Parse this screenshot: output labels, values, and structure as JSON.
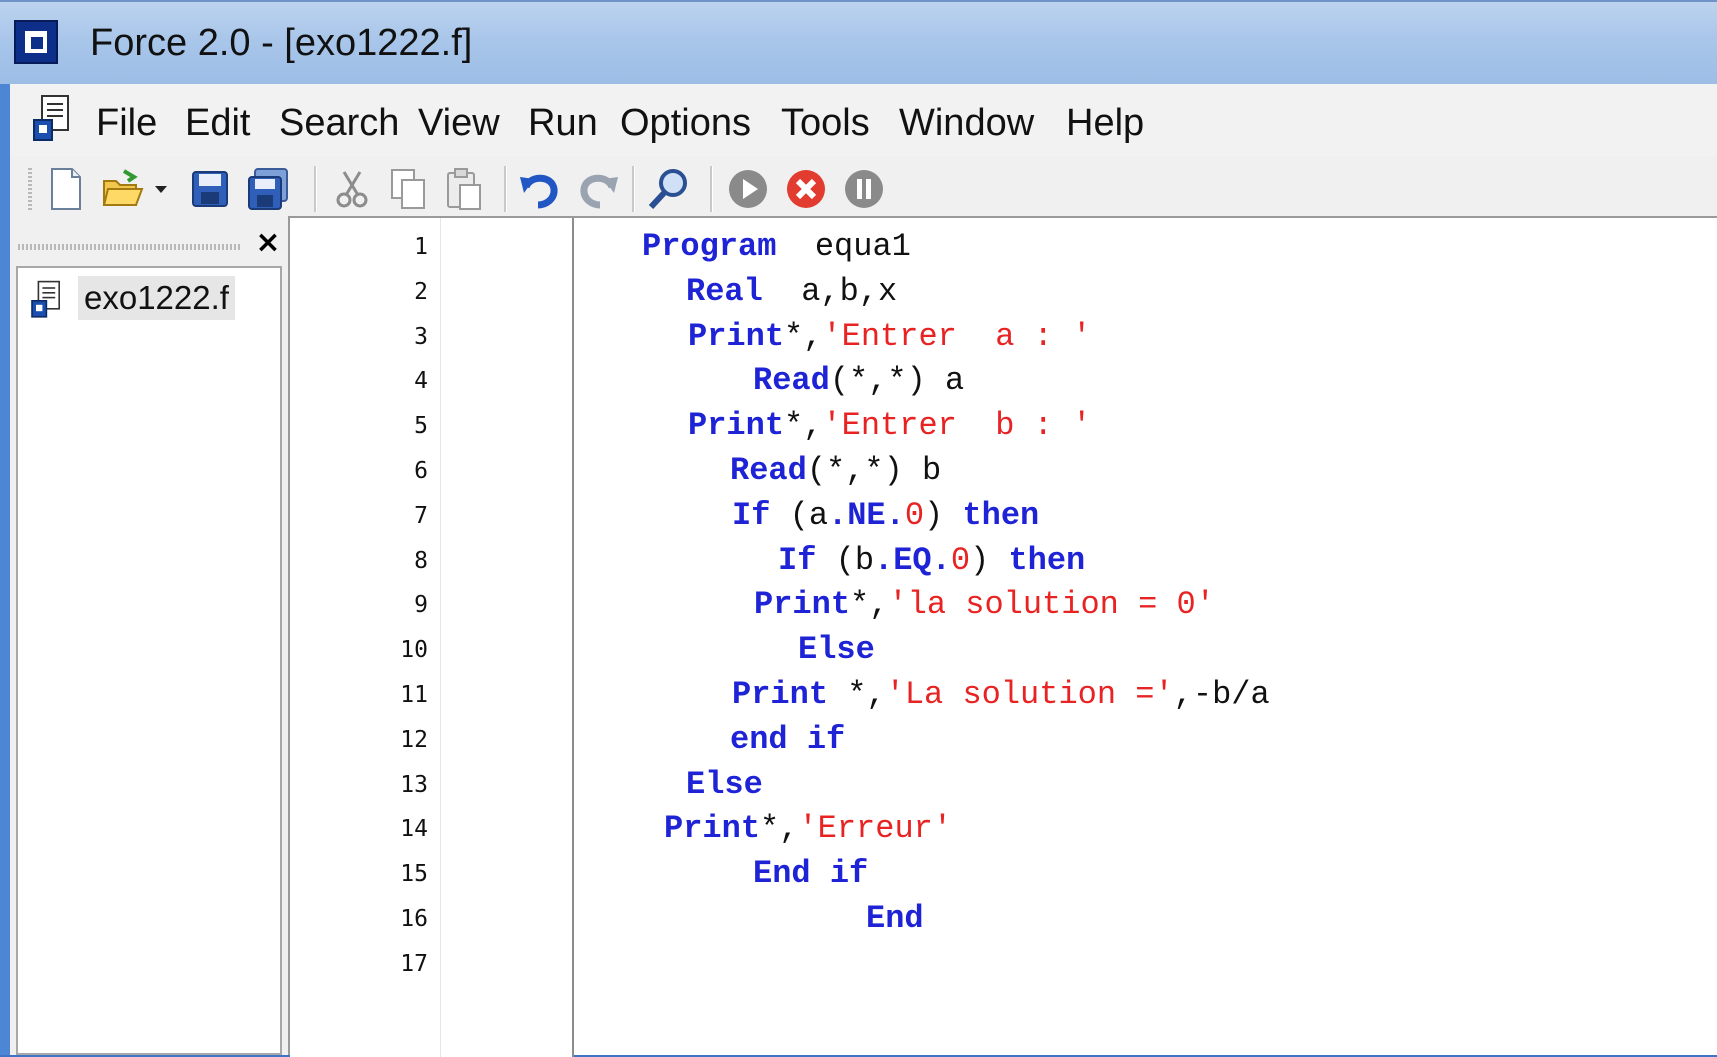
{
  "window": {
    "title": "Force 2.0 - [exo1222.f]"
  },
  "menu": {
    "items": [
      "File",
      "Edit",
      "Search",
      "View",
      "Run",
      "Options",
      "Tools",
      "Window",
      "Help"
    ]
  },
  "toolbar": {
    "buttons": [
      "new-file-icon",
      "open-file-icon",
      "dropdown-arrow-icon",
      "save-icon",
      "save-all-icon",
      "cut-icon",
      "copy-icon",
      "paste-icon",
      "undo-icon",
      "redo-icon",
      "find-icon",
      "run-icon",
      "stop-icon",
      "pause-icon"
    ]
  },
  "sidebar": {
    "close_label": "×",
    "files": [
      {
        "name": "exo1222.f",
        "selected": true
      }
    ]
  },
  "editor": {
    "line_numbers": [
      "1",
      "2",
      "3",
      "4",
      "5",
      "6",
      "7",
      "8",
      "9",
      "10",
      "11",
      "12",
      "13",
      "14",
      "15",
      "16",
      "17"
    ],
    "lines": [
      [
        {
          "t": "Program",
          "c": "kw"
        },
        {
          "t": "  equa1",
          "c": ""
        }
      ],
      [
        {
          "t": "Real",
          "c": "kw"
        },
        {
          "t": "  a,b,x",
          "c": ""
        }
      ],
      [
        {
          "t": "Print",
          "c": "kw"
        },
        {
          "t": "*,",
          "c": ""
        },
        {
          "t": "'Entrer  a : '",
          "c": "str"
        }
      ],
      [
        {
          "t": "Read",
          "c": "kw"
        },
        {
          "t": "(*,*) a",
          "c": ""
        }
      ],
      [
        {
          "t": "Print",
          "c": "kw"
        },
        {
          "t": "*,",
          "c": ""
        },
        {
          "t": "'Entrer  b : '",
          "c": "str"
        }
      ],
      [
        {
          "t": "Read",
          "c": "kw"
        },
        {
          "t": "(*,*) b",
          "c": ""
        }
      ],
      [
        {
          "t": "If",
          "c": "kw"
        },
        {
          "t": " (a",
          "c": ""
        },
        {
          "t": ".NE.",
          "c": "op"
        },
        {
          "t": "0",
          "c": "num"
        },
        {
          "t": ") ",
          "c": ""
        },
        {
          "t": "then",
          "c": "kw"
        }
      ],
      [
        {
          "t": "If",
          "c": "kw"
        },
        {
          "t": " (b",
          "c": ""
        },
        {
          "t": ".EQ.",
          "c": "op"
        },
        {
          "t": "0",
          "c": "num"
        },
        {
          "t": ") ",
          "c": ""
        },
        {
          "t": "then",
          "c": "kw"
        }
      ],
      [
        {
          "t": "Print",
          "c": "kw"
        },
        {
          "t": "*,",
          "c": ""
        },
        {
          "t": "'la solution = 0'",
          "c": "str"
        }
      ],
      [
        {
          "t": "Else",
          "c": "kw"
        }
      ],
      [
        {
          "t": "Print",
          "c": "kw"
        },
        {
          "t": " *,",
          "c": ""
        },
        {
          "t": "'La solution ='",
          "c": "str"
        },
        {
          "t": ",-b/a",
          "c": ""
        }
      ],
      [
        {
          "t": "end if",
          "c": "kw"
        }
      ],
      [
        {
          "t": "Else",
          "c": "kw"
        }
      ],
      [
        {
          "t": "Print",
          "c": "kw"
        },
        {
          "t": "*,",
          "c": ""
        },
        {
          "t": "'Erreur'",
          "c": "str"
        }
      ],
      [
        {
          "t": "End if",
          "c": "kw"
        }
      ],
      [
        {
          "t": "End",
          "c": "kw"
        }
      ],
      []
    ]
  },
  "colors": {
    "keyword": "#1f23d6",
    "string": "#e82323",
    "titlebar": "#a9c6ea",
    "frame": "#4e86d6"
  }
}
